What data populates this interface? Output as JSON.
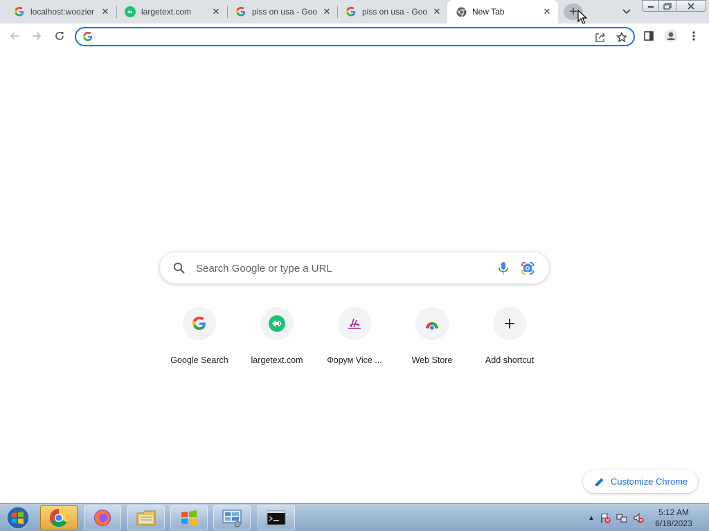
{
  "tabs": [
    {
      "title": "localhost:woozier",
      "favicon": "google-g-icon"
    },
    {
      "title": "largetext.com",
      "favicon": "largetext-icon"
    },
    {
      "title": "piss on usa - Goo",
      "favicon": "google-g-icon"
    },
    {
      "title": "piss on usa - Goo",
      "favicon": "google-g-icon"
    },
    {
      "title": "New Tab",
      "favicon": "chrome-icon",
      "active": true
    }
  ],
  "omnibox": {
    "value": "",
    "placeholder": ""
  },
  "ntp": {
    "search_placeholder": "Search Google or type a URL",
    "shortcuts": [
      {
        "label": "Google Search",
        "icon": "google-g-icon"
      },
      {
        "label": "largetext.com",
        "icon": "largetext-icon"
      },
      {
        "label": "Форум Vice ...",
        "icon": "vice-forum-icon"
      },
      {
        "label": "Web Store",
        "icon": "web-store-icon"
      },
      {
        "label": "Add shortcut",
        "icon": "plus-icon"
      }
    ],
    "customize_label": "Customize Chrome"
  },
  "taskbar": {
    "apps": [
      "chrome",
      "firefox",
      "file-explorer",
      "windows-update",
      "control-panel",
      "command-prompt"
    ],
    "clock_time": "5:12 AM",
    "clock_date": "6/18/2023"
  },
  "colors": {
    "accent": "#1a73e8",
    "tabstrip": "#dee1e6",
    "taskbar": "#9fb8d4"
  }
}
